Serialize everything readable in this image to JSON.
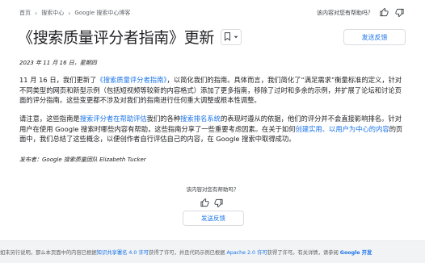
{
  "breadcrumb": [
    "首页",
    "搜索中心",
    "Google 搜索中心博客"
  ],
  "feedback_prompt_top": "该内容对您有帮助吗？",
  "title": "《搜索质量评分者指南》更新",
  "send_feedback": "发送反馈",
  "date": "2023 年 11 月 16 日，星期四",
  "p1": {
    "t1": "11 月 16 日，我们更新了",
    "link1": "《搜索质量评分者指南》",
    "t2": "，以简化我们的指南。具体而言，我们简化了“满足需求”衡量标准的定义，针对不同类型的网页和新型示例（包括短视频等较新的内容格式）添加了更多指南，移除了过时和多余的示例，并扩展了论坛和讨论页面的评分指南。这些变更都不涉及对我们的指南进行任何重大调整或根本性调整。"
  },
  "p2": {
    "t1": "请注意，这些指南是",
    "link1": "搜索评分者在帮助评估",
    "t2": "我们的各种",
    "link2": "搜索排名系统",
    "t3": "的表现时遵从的依据，他们的评分并不会直接影响排名。针对用户在使用 Google 搜索时哪些内容有帮助，这些指南分享了一些重要考虑因素。在关于如何",
    "link3": "创建实用、以用户为中心的内容",
    "t4": "的页面中，我们总结了这些概念，以便创作者自行评估自己的内容，在 Google 搜索中取得成功。"
  },
  "author": "发布者：Google 搜索质量团队 Elizabeth Tucker",
  "feedback_prompt_bottom": "该内容对您有帮助吗？",
  "send_feedback_bottom": "发送反馈",
  "footer": {
    "t1": "如未另行说明，那么本页面中的内容已根据",
    "link1": "知识共享署名 4.0 许可",
    "t2": "获得了许可，并且代码示例已根据 ",
    "link2": "Apache 2.0 许可",
    "t3": "获得了许可。有关详情，请参阅 ",
    "link3": "Google 开发"
  }
}
